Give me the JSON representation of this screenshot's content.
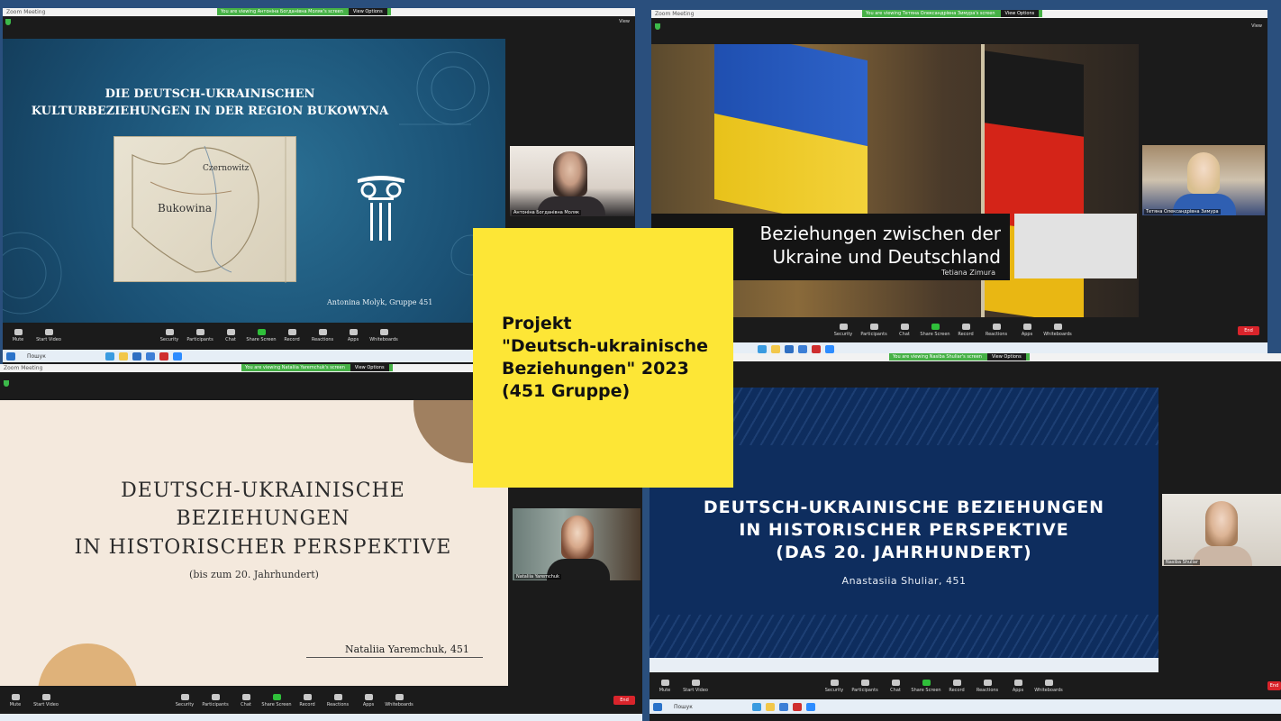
{
  "meeting_window": "Zoom Meeting",
  "toolbar": {
    "mute": "Mute",
    "start_video": "Start Video",
    "security": "Security",
    "participants": "Participants",
    "chat": "Chat",
    "share_screen": "Share Screen",
    "record": "Record",
    "reactions": "Reactions",
    "apps": "Apps",
    "whiteboards": "Whiteboards",
    "end": "End"
  },
  "view_label": "View",
  "view_options": "View Options",
  "taskbar": {
    "search": "Пошук"
  },
  "quadrants": [
    {
      "banner": "You are viewing Антоніна Богданівна Моляк's screen",
      "slide": {
        "title": "DIE DEUTSCH-UKRAINISCHEN KULTURBEZIEHUNGEN IN DER REGION BUKOWYNA",
        "map_labels": [
          "Czernowitz",
          "Bukowina"
        ],
        "author": "Antonina Molyk, Gruppe 451"
      },
      "participant": "Антоніна Богданівна Моляк"
    },
    {
      "banner": "You are viewing Тетяна Олександрівна Зимура's screen",
      "slide": {
        "title_line1": "Beziehungen zwischen der",
        "title_line2": "Ukraine und Deutschland",
        "author": "Tetiana Zimura"
      },
      "participant": "Тетяна Олександрівна Зимура"
    },
    {
      "banner": "You are viewing Nataliia Yaremchuk's screen",
      "slide": {
        "title_line1": "DEUTSCH-UKRAINISCHE",
        "title_line2": "BEZIEHUNGEN",
        "title_line3": "IN HISTORISCHER PERSPEKTIVE",
        "subtitle": "(bis zum 20. Jahrhundert)",
        "author": "Nataliia Yaremchuk, 451"
      },
      "participant": "Nataliia Yaremchuk"
    },
    {
      "banner": "You are viewing Nasiba Shuliar's screen",
      "slide": {
        "title_line1": "DEUTSCH-UKRAINISCHE BEZIEHUNGEN",
        "title_line2": "IN HISTORISCHER PERSPEKTIVE",
        "title_line3": "(DAS 20. JAHRHUNDERT)",
        "author": "Anastasiia Shuliar, 451"
      },
      "participant": "Nasiba Shuliar"
    }
  ],
  "project_card": {
    "text": "Projekt\n\"Deutsch-ukrainische\nBeziehungen\" 2023\n(451 Gruppe)"
  },
  "colors": {
    "desktop": "#2a4f7d",
    "slide1_bg": "#1f5a7e",
    "slide3_bg": "#f4e9dd",
    "slide4_bg": "#0e2d5e",
    "yellow": "#fde636",
    "share_green": "#2fbf3a",
    "end_red": "#d9242b"
  }
}
